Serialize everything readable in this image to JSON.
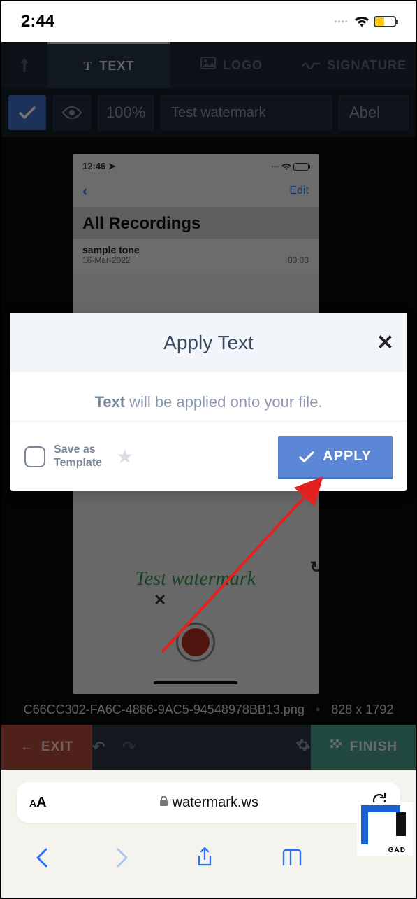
{
  "statusbar": {
    "time": "2:44"
  },
  "tabs": {
    "text": "TEXT",
    "logo": "LOGO",
    "signature": "SIGNATURE"
  },
  "toolbar": {
    "opacity": "100%",
    "input_value": "Test watermark",
    "font": "Abel"
  },
  "canvas": {
    "status_time": "12:46",
    "edit": "Edit",
    "title": "All Recordings",
    "item_name": "sample tone",
    "item_date": "16-Mar-2022",
    "item_dur": "00:03",
    "watermark": "Test watermark"
  },
  "fileinfo": {
    "name": "C66CC302-FA6C-4886-9AC5-94548978BB13.png",
    "dims": "828 x 1792"
  },
  "bottombar": {
    "exit": "EXIT",
    "finish": "FINISH"
  },
  "modal": {
    "title": "Apply Text",
    "desc_bold": "Text",
    "desc_rest": " will be applied onto your file.",
    "save_tmpl_l1": "Save as",
    "save_tmpl_l2": "Template",
    "apply": "APPLY"
  },
  "safari": {
    "url": "watermark.ws"
  },
  "logo_txt": "GAD"
}
